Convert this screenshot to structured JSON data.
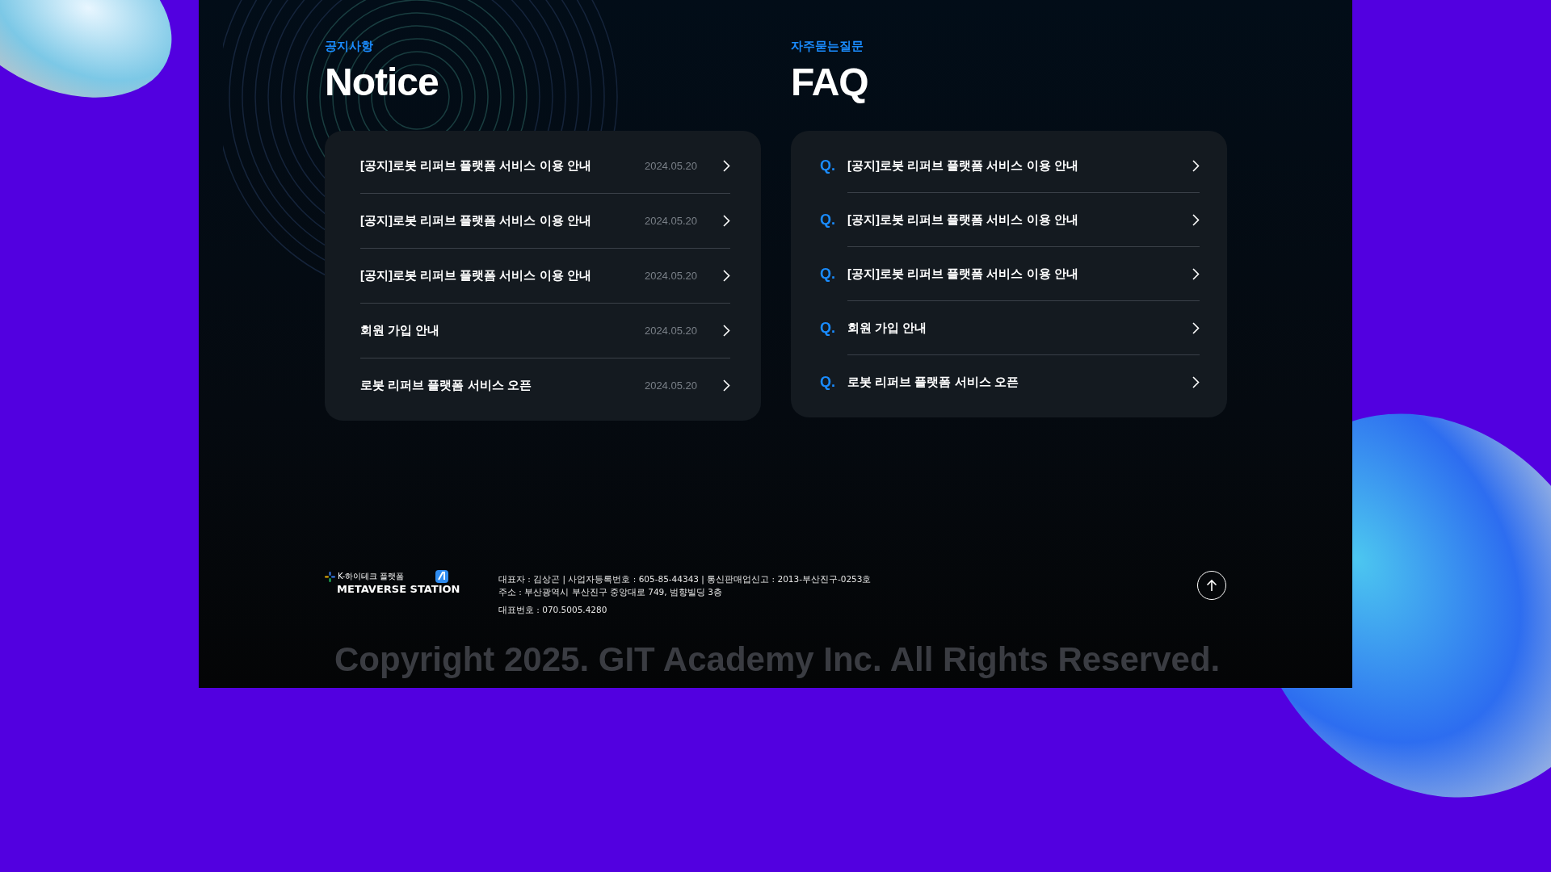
{
  "notice": {
    "label": "공지사항",
    "title": "Notice",
    "items": [
      {
        "title": "[공지]로봇 리퍼브 플랫폼 서비스 이용 안내",
        "date": "2024.05.20"
      },
      {
        "title": "[공지]로봇 리퍼브 플랫폼 서비스 이용 안내",
        "date": "2024.05.20"
      },
      {
        "title": "[공지]로봇 리퍼브 플랫폼 서비스 이용 안내",
        "date": "2024.05.20"
      },
      {
        "title": "회원 가입 안내",
        "date": "2024.05.20"
      },
      {
        "title": "로봇 리퍼브 플랫폼 서비스 오픈",
        "date": "2024.05.20"
      }
    ]
  },
  "faq": {
    "label": "자주묻는질문",
    "title": "FAQ",
    "items": [
      {
        "marker": "Q.",
        "title": "[공지]로봇 리퍼브 플랫폼 서비스 이용 안내"
      },
      {
        "marker": "Q.",
        "title": "[공지]로봇 리퍼브 플랫폼 서비스 이용 안내"
      },
      {
        "marker": "Q.",
        "title": "[공지]로봇 리퍼브 플랫폼 서비스 이용 안내"
      },
      {
        "marker": "Q.",
        "title": "회원 가입 안내"
      },
      {
        "marker": "Q.",
        "title": "로봇 리퍼브 플랫폼 서비스 오픈"
      }
    ]
  },
  "footer": {
    "logo_tagline": "K-하이테크 플랫폼",
    "logo_name": "METAVERSE STATION",
    "info_lines": [
      "대표자 : 김상곤 | 사업자등록번호 : 605-85-44343 | 통신판매업신고 : 2013-부산진구-0253호",
      "주소 : 부산광역시 부산진구 중앙대로 749, 범향빌딩 3층"
    ],
    "phone": "대표번호 : 070.5005.4280",
    "copyright": "Copyright 2025. GIT Academy Inc.  All Rights Reserved."
  }
}
